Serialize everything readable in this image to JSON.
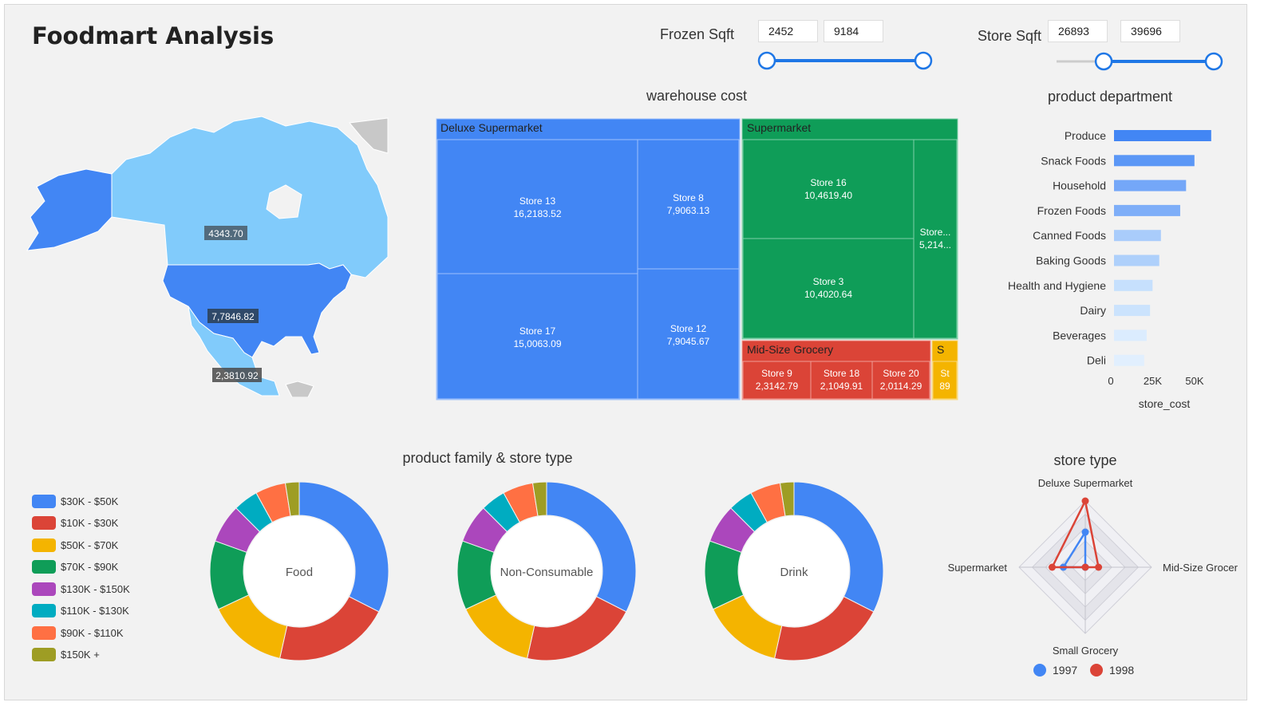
{
  "app_title": "Foodmart Analysis",
  "frozen_sqft": {
    "label": "Frozen Sqft",
    "min": "2452",
    "max": "9184",
    "low_fraction": 0.0,
    "high_fraction": 1.0
  },
  "store_sqft": {
    "label": "Store Sqft",
    "min": "26893",
    "max": "39696",
    "low_fraction": 0.3,
    "high_fraction": 1.0
  },
  "map": {
    "labels": [
      {
        "country": "Canada",
        "value": "4343.70"
      },
      {
        "country": "United States",
        "value": "7,7846.82"
      },
      {
        "country": "Mexico",
        "value": "2,3810.92"
      }
    ],
    "colors": {
      "usa": "#4286f4",
      "canada": "#81cbfb",
      "mexico": "#81cbfb",
      "greenland": "#c8c8c8",
      "ocean": "#f2f2f2"
    }
  },
  "warehouse_cost": {
    "title": "warehouse cost",
    "groups": [
      {
        "name": "Deluxe Supermarket",
        "color": "#4286f4",
        "stores": [
          {
            "name": "Store 13",
            "value": "16,2183.52"
          },
          {
            "name": "Store 8",
            "value": "7,9063.13"
          },
          {
            "name": "Store 17",
            "value": "15,0063.09"
          },
          {
            "name": "Store 12",
            "value": "7,9045.67"
          }
        ]
      },
      {
        "name": "Supermarket",
        "color": "#0f9d58",
        "stores": [
          {
            "name": "Store 16",
            "value": "10,4619.40"
          },
          {
            "name": "Store 3",
            "value": "10,4020.64"
          },
          {
            "name": "Store...",
            "value": "5,214..."
          }
        ]
      },
      {
        "name": "Mid-Size Grocery",
        "color": "#db4437",
        "stores": [
          {
            "name": "Store 9",
            "value": "2,3142.79"
          },
          {
            "name": "Store 18",
            "value": "2,1049.91"
          },
          {
            "name": "Store 20",
            "value": "2,0114.29"
          }
        ]
      },
      {
        "name": "S",
        "color": "#f4b400",
        "stores": [
          {
            "name": "St",
            "value": "89"
          }
        ]
      }
    ]
  },
  "product_department": {
    "title": "product department",
    "chart_data": {
      "type": "bar",
      "orientation": "horizontal",
      "categories": [
        "Produce",
        "Snack Foods",
        "Household",
        "Frozen Foods",
        "Canned Foods",
        "Baking Goods",
        "Health and Hygiene",
        "Dairy",
        "Beverages",
        "Deli"
      ],
      "values": [
        58000,
        48000,
        43000,
        39500,
        28000,
        27000,
        23000,
        21500,
        19500,
        18000
      ],
      "xlim": [
        0,
        60000
      ],
      "xticks": [
        "0",
        "25K",
        "50K"
      ],
      "xlabel": "store_cost",
      "colors": [
        "#4286f4",
        "#5b97f6",
        "#74a7f8",
        "#7eaef8",
        "#a9ccfb",
        "#aed0fb",
        "#c6e0fd",
        "#cbe3fd",
        "#dbecfe",
        "#e1effe"
      ]
    }
  },
  "product_family": {
    "title": "product family & store type",
    "legend": [
      {
        "label": "$30K - $50K",
        "color": "#4286f4"
      },
      {
        "label": "$10K - $30K",
        "color": "#db4437"
      },
      {
        "label": "$50K - $70K",
        "color": "#f4b400"
      },
      {
        "label": "$70K - $90K",
        "color": "#0f9d58"
      },
      {
        "label": "$130K - $150K",
        "color": "#ab47bc"
      },
      {
        "label": "$110K - $130K",
        "color": "#00acc1"
      },
      {
        "label": "$90K - $110K",
        "color": "#ff7043"
      },
      {
        "label": "$150K +",
        "color": "#9e9d24"
      }
    ],
    "chart_data": [
      {
        "type": "pie",
        "name": "Food",
        "values": [
          32.5,
          21,
          14.5,
          12.5,
          7,
          4.5,
          5.5,
          2.5
        ]
      },
      {
        "type": "pie",
        "name": "Non-Consumable",
        "values": [
          32.5,
          21,
          14.5,
          12.5,
          7,
          4.5,
          5.5,
          2.5
        ]
      },
      {
        "type": "pie",
        "name": "Drink",
        "values": [
          32.5,
          21,
          14.5,
          12.5,
          7,
          4.5,
          5.5,
          2.5
        ]
      }
    ]
  },
  "store_type": {
    "title": "store type",
    "chart_data": {
      "type": "radar",
      "axes": [
        "Deluxe Supermarket",
        "Mid-Size Grocery",
        "Small Grocery",
        "Supermarket"
      ],
      "axis_labels_shown": [
        "Deluxe Supermarket",
        "Mid-Size Grocer",
        "Small Grocery",
        "Supermarket"
      ],
      "max": 1,
      "series": [
        {
          "name": "1997",
          "color": "#4286f4",
          "values": [
            0.53,
            0.0,
            0.0,
            0.33
          ]
        },
        {
          "name": "1998",
          "color": "#db4437",
          "values": [
            1.0,
            0.2,
            0.0,
            0.5
          ]
        }
      ]
    }
  }
}
